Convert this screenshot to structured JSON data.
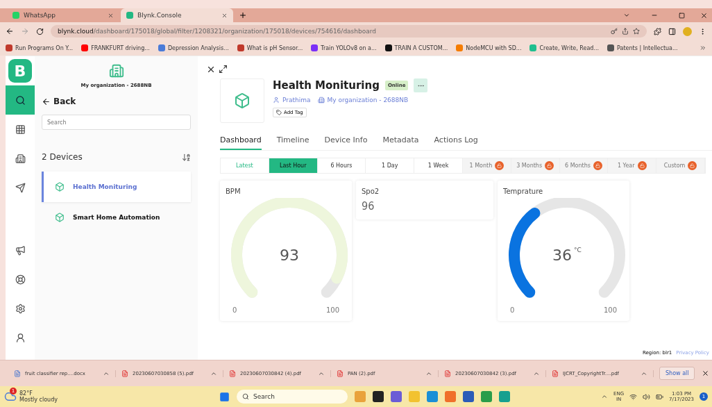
{
  "browser": {
    "tabs": [
      {
        "label": "WhatsApp",
        "selected": false
      },
      {
        "label": "Blynk.Console",
        "selected": true
      }
    ],
    "url_host": "blynk.cloud",
    "url_path": "/dashboard/175018/global/filter/1208321/organization/175018/devices/754616/dashboard",
    "bookmarks": [
      {
        "label": "Run Programs On Y...",
        "color": "#c0392b"
      },
      {
        "label": "FRANKFURT driving...",
        "color": "#ff0000"
      },
      {
        "label": "Depression Analysis...",
        "color": "#4a7bd8"
      },
      {
        "label": "What is pH Sensor...",
        "color": "#c0392b"
      },
      {
        "label": "Train YOLOv8 on a...",
        "color": "#7b2ff7"
      },
      {
        "label": "TRAIN A CUSTOM...",
        "color": "#111111"
      },
      {
        "label": "NodeMCU with SD...",
        "color": "#f57c00"
      },
      {
        "label": "Create, Write, Read...",
        "color": "#1fbf8f"
      },
      {
        "label": "Patents | Intellectua...",
        "color": "#555555"
      }
    ]
  },
  "nav": [
    {
      "selected": true
    },
    {
      "selected": false
    },
    {
      "selected": false
    },
    {
      "selected": false
    },
    {
      "selected": false
    },
    {
      "selected": false
    },
    {
      "selected": false
    },
    {
      "selected": false
    }
  ],
  "logo": "B",
  "org_name": "My organization - 2688NB",
  "back": "Back",
  "search": {
    "placeholder": "Search"
  },
  "device_count": "2 Devices",
  "devices": [
    {
      "name": "Health Monituring",
      "selected": true
    },
    {
      "name": "Smart Home Automation",
      "selected": false
    }
  ],
  "device": {
    "title": "Health Monituring",
    "status": "Online",
    "owner": "Prathima",
    "org": "My organization - 2688NB",
    "add_tag": "Add Tag"
  },
  "detail_tabs": [
    {
      "label": "Dashboard",
      "selected": true
    },
    {
      "label": "Timeline",
      "selected": false
    },
    {
      "label": "Device Info",
      "selected": false
    },
    {
      "label": "Metadata",
      "selected": false
    },
    {
      "label": "Actions Log",
      "selected": false
    }
  ],
  "ranges": [
    {
      "label": "Latest",
      "selected": false,
      "locked": false
    },
    {
      "label": "Last Hour",
      "selected": true,
      "locked": false
    },
    {
      "label": "6 Hours",
      "selected": false,
      "locked": false
    },
    {
      "label": "1 Day",
      "selected": false,
      "locked": false
    },
    {
      "label": "1 Week",
      "selected": false,
      "locked": false
    },
    {
      "label": "1 Month",
      "selected": false,
      "locked": true
    },
    {
      "label": "3 Months",
      "selected": false,
      "locked": true
    },
    {
      "label": "6 Months",
      "selected": false,
      "locked": true
    },
    {
      "label": "1 Year",
      "selected": false,
      "locked": true
    },
    {
      "label": "Custom",
      "selected": false,
      "locked": true
    }
  ],
  "widgets": [
    {
      "kind": "gauge",
      "title": "BPM",
      "value": "93",
      "color": "#eef6dc",
      "min": "0",
      "max": "100"
    },
    {
      "kind": "value",
      "title": "Spo2",
      "value": "96"
    },
    {
      "kind": "gauge",
      "title": "Temprature",
      "value": "36",
      "unit": "°C",
      "color": "#0a73e0",
      "min": "0",
      "max": "100"
    }
  ],
  "footer": {
    "region": "Region: blr1",
    "privacy": "Privacy Policy"
  },
  "downloads": [
    "fruit classifier rep....docx",
    "20230607030858 (5).pdf",
    "20230607030842 (4).pdf",
    "PAN (2).pdf",
    "20230607030842 (3).pdf",
    "IJCRT_CopyrightTr....pdf"
  ],
  "show_all": "Show all",
  "taskbar": {
    "weather_badge": "1",
    "temperature": "82°F",
    "weather": "Mostly cloudy",
    "search": {
      "placeholder": "Search"
    },
    "lang": "ENG",
    "region": "IN",
    "time": "1:03 PM",
    "date": "7/17/2023",
    "notifications": "1"
  }
}
